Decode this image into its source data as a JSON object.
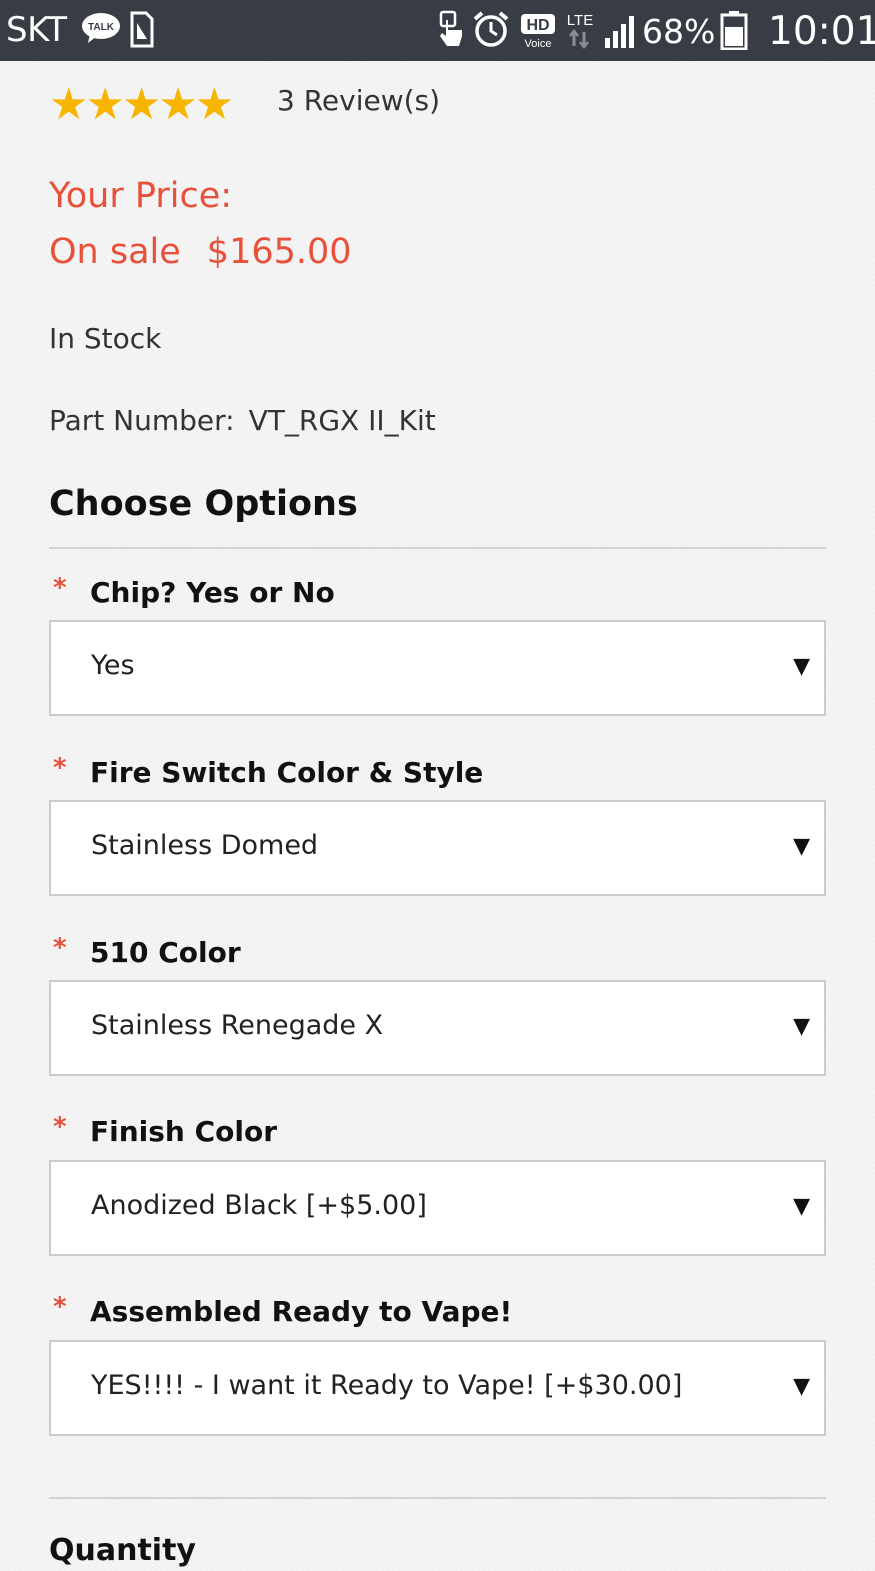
{
  "status_bar": {
    "carrier": "SKT",
    "talk_icon_text": "TALK",
    "hd_text": "HD",
    "voice_text": "Voice",
    "lte_text": "LTE",
    "battery_percent": "68%",
    "battery_level": 0.68,
    "time": "10:01"
  },
  "product": {
    "rating_stars": 5,
    "stars_text": "★★★★★",
    "reviews_text": "3 Review(s)",
    "price_label": "Your Price:",
    "sale_text": "On sale",
    "price": "$165.00",
    "stock_status": "In Stock",
    "part_number_label": "Part Number:",
    "part_number": "VT_RGX II_Kit"
  },
  "options": {
    "title": "Choose Options",
    "required_marker": "*",
    "items": [
      {
        "label": "Chip? Yes or No",
        "selected": "Yes"
      },
      {
        "label": "Fire Switch Color & Style",
        "selected": "Stainless Domed"
      },
      {
        "label": "510 Color",
        "selected": "Stainless Renegade X"
      },
      {
        "label": "Finish Color",
        "selected": "Anodized Black [+$5.00]"
      },
      {
        "label": "Assembled Ready to Vape!",
        "selected": "YES!!!! - I want it Ready to Vape! [+$30.00]"
      }
    ],
    "caret_glyph": "▼"
  },
  "quantity": {
    "label": "Quantity"
  },
  "colors": {
    "accent": "#e8503a",
    "star": "#f7b500",
    "status_bar_bg": "#383d45"
  }
}
